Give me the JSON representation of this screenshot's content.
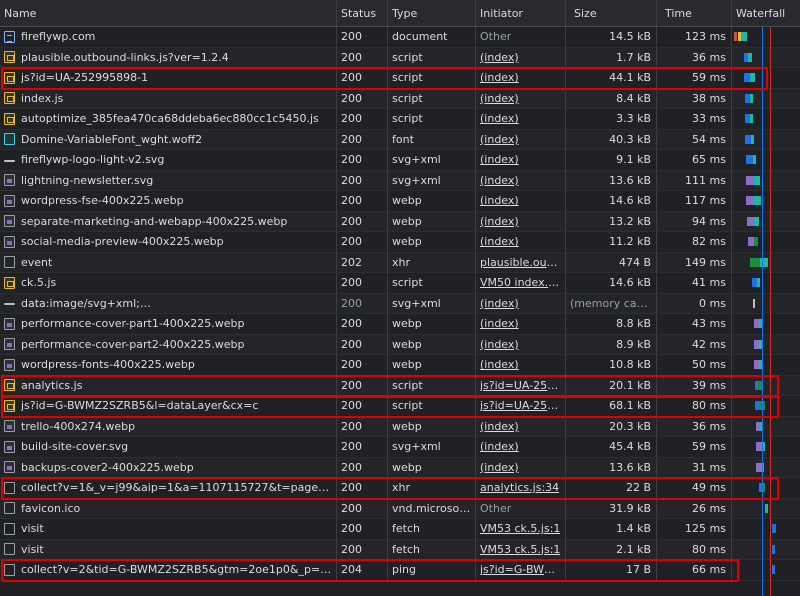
{
  "columns": {
    "name": "Name",
    "status": "Status",
    "type": "Type",
    "initiator": "Initiator",
    "size": "Size",
    "time": "Time",
    "waterfall": "Waterfall"
  },
  "rows": [
    {
      "icon": "document-icon",
      "name": "fireflywp.com",
      "status": "200",
      "type": "document",
      "initiator": "Other",
      "init_link": false,
      "size": "14.5 kB",
      "time": "123 ms"
    },
    {
      "icon": "script-icon",
      "name": "plausible.outbound-links.js?ver=1.2.4",
      "status": "200",
      "type": "script",
      "initiator": "(index)",
      "init_link": true,
      "size": "1.7 kB",
      "time": "36 ms"
    },
    {
      "icon": "script-icon",
      "name": "js?id=UA-252995898-1",
      "status": "200",
      "type": "script",
      "initiator": "(index)",
      "init_link": true,
      "size": "44.1 kB",
      "time": "59 ms"
    },
    {
      "icon": "script-icon",
      "name": "index.js",
      "status": "200",
      "type": "script",
      "initiator": "(index)",
      "init_link": true,
      "size": "8.4 kB",
      "time": "38 ms"
    },
    {
      "icon": "script-icon",
      "name": "autoptimize_385fea470ca68ddeba6ec880cc1c5450.js",
      "status": "200",
      "type": "script",
      "initiator": "(index)",
      "init_link": true,
      "size": "3.3 kB",
      "time": "33 ms"
    },
    {
      "icon": "font-icon",
      "name": "Domine-VariableFont_wght.woff2",
      "status": "200",
      "type": "font",
      "initiator": "(index)",
      "init_link": true,
      "size": "40.3 kB",
      "time": "54 ms"
    },
    {
      "icon": "svg-icon",
      "name": "fireflywp-logo-light-v2.svg",
      "status": "200",
      "type": "svg+xml",
      "initiator": "(index)",
      "init_link": true,
      "size": "9.1 kB",
      "time": "65 ms"
    },
    {
      "icon": "image-icon",
      "name": "lightning-newsletter.svg",
      "status": "200",
      "type": "svg+xml",
      "initiator": "(index)",
      "init_link": true,
      "size": "13.6 kB",
      "time": "111 ms"
    },
    {
      "icon": "image-icon",
      "name": "wordpress-fse-400x225.webp",
      "status": "200",
      "type": "webp",
      "initiator": "(index)",
      "init_link": true,
      "size": "14.6 kB",
      "time": "117 ms"
    },
    {
      "icon": "image-icon",
      "name": "separate-marketing-and-webapp-400x225.webp",
      "status": "200",
      "type": "webp",
      "initiator": "(index)",
      "init_link": true,
      "size": "13.2 kB",
      "time": "94 ms"
    },
    {
      "icon": "image-icon",
      "name": "social-media-preview-400x225.webp",
      "status": "200",
      "type": "webp",
      "initiator": "(index)",
      "init_link": true,
      "size": "11.2 kB",
      "time": "82 ms"
    },
    {
      "icon": "blank-icon",
      "name": "event",
      "status": "202",
      "type": "xhr",
      "initiator": "plausible.outb…",
      "init_link": true,
      "size": "474 B",
      "time": "149 ms"
    },
    {
      "icon": "script-icon",
      "name": "ck.5.js",
      "status": "200",
      "type": "script",
      "initiator": "VM50 index.js:1",
      "init_link": true,
      "size": "14.6 kB",
      "time": "41 ms"
    },
    {
      "icon": "svg-icon",
      "name": "data:image/svg+xml;…",
      "status": "200",
      "status_dim": true,
      "type": "svg+xml",
      "initiator": "(index)",
      "init_link": true,
      "size": "(memory cache)",
      "size_dim": true,
      "time": "0 ms"
    },
    {
      "icon": "image-icon",
      "name": "performance-cover-part1-400x225.webp",
      "status": "200",
      "type": "webp",
      "initiator": "(index)",
      "init_link": true,
      "size": "8.8 kB",
      "time": "43 ms"
    },
    {
      "icon": "image-icon",
      "name": "performance-cover-part2-400x225.webp",
      "status": "200",
      "type": "webp",
      "initiator": "(index)",
      "init_link": true,
      "size": "8.9 kB",
      "time": "42 ms"
    },
    {
      "icon": "image-icon",
      "name": "wordpress-fonts-400x225.webp",
      "status": "200",
      "type": "webp",
      "initiator": "(index)",
      "init_link": true,
      "size": "10.8 kB",
      "time": "50 ms"
    },
    {
      "icon": "script-icon",
      "name": "analytics.js",
      "status": "200",
      "type": "script",
      "initiator": "js?id=UA-252…",
      "init_link": true,
      "size": "20.1 kB",
      "time": "39 ms"
    },
    {
      "icon": "script-icon",
      "name": "js?id=G-BWMZ2SZRB5&l=dataLayer&cx=c",
      "status": "200",
      "type": "script",
      "initiator": "js?id=UA-252…",
      "init_link": true,
      "size": "68.1 kB",
      "time": "80 ms"
    },
    {
      "icon": "image-icon",
      "name": "trello-400x274.webp",
      "status": "200",
      "type": "webp",
      "initiator": "(index)",
      "init_link": true,
      "size": "20.3 kB",
      "time": "36 ms"
    },
    {
      "icon": "image-icon",
      "name": "build-site-cover.svg",
      "status": "200",
      "type": "svg+xml",
      "initiator": "(index)",
      "init_link": true,
      "size": "45.4 kB",
      "time": "59 ms"
    },
    {
      "icon": "image-icon",
      "name": "backups-cover2-400x225.webp",
      "status": "200",
      "type": "webp",
      "initiator": "(index)",
      "init_link": true,
      "size": "13.6 kB",
      "time": "31 ms"
    },
    {
      "icon": "blank-icon",
      "name": "collect?v=1&_v=j99&aip=1&a=1107115727&t=pageview…",
      "status": "200",
      "type": "xhr",
      "initiator": "analytics.js:34",
      "init_link": true,
      "size": "22 B",
      "time": "49 ms"
    },
    {
      "icon": "blank-icon",
      "name": "favicon.ico",
      "status": "200",
      "type": "vnd.microsoft…",
      "initiator": "Other",
      "init_link": false,
      "size": "31.9 kB",
      "time": "26 ms"
    },
    {
      "icon": "blank-icon",
      "name": "visit",
      "status": "200",
      "type": "fetch",
      "initiator": "VM53 ck.5.js:1",
      "init_link": true,
      "size": "1.4 kB",
      "time": "125 ms"
    },
    {
      "icon": "blank-icon",
      "name": "visit",
      "status": "200",
      "type": "fetch",
      "initiator": "VM53 ck.5.js:1",
      "init_link": true,
      "size": "2.1 kB",
      "time": "80 ms"
    },
    {
      "icon": "blank-icon",
      "name": "collect?v=2&tid=G-BWMZ2SZRB5&gtm=2oe1p0&_p=11…",
      "status": "204",
      "type": "ping",
      "initiator": "js?id=G-BWM…",
      "init_link": true,
      "size": "17 B",
      "time": "66 ms"
    }
  ],
  "highlighted_rows": [
    2,
    17,
    18,
    22,
    26
  ],
  "colors": {
    "highlight": "#e00000",
    "waterfall_blue": "#1a73e8",
    "waterfall_teal": "#1fb8a5",
    "waterfall_green": "#1e8e3e",
    "dom_line": "#1a73e8",
    "load_line": "#d93025"
  }
}
